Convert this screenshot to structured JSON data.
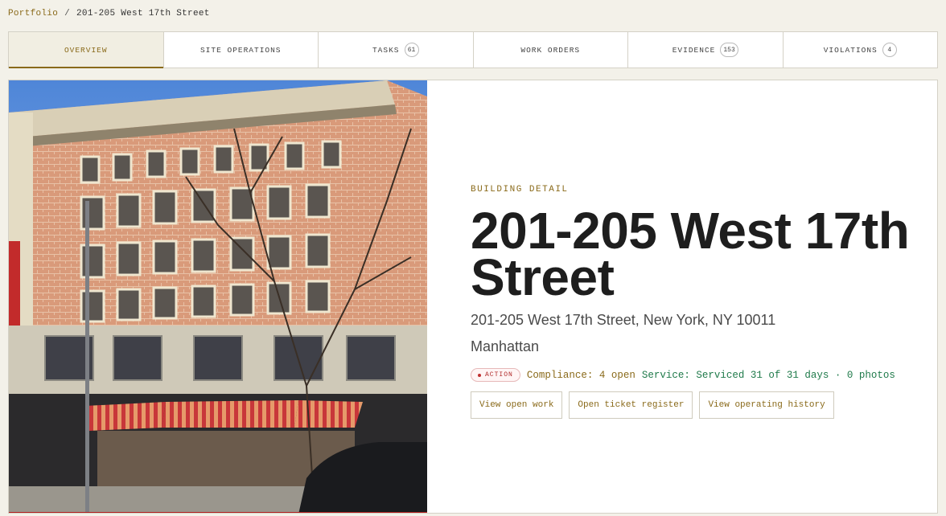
{
  "breadcrumb": {
    "root": "Portfolio",
    "separator": "/",
    "current": "201-205 West 17th Street"
  },
  "tabs": [
    {
      "label": "OVERVIEW",
      "badge": null
    },
    {
      "label": "SITE OPERATIONS",
      "badge": null
    },
    {
      "label": "TASKS",
      "badge": "61"
    },
    {
      "label": "WORK ORDERS",
      "badge": null
    },
    {
      "label": "EVIDENCE",
      "badge": "153"
    },
    {
      "label": "VIOLATIONS",
      "badge": "4"
    }
  ],
  "building": {
    "eyebrow": "BUILDING DETAIL",
    "title_line1": "201-205 West 17th",
    "title_line2": "Street",
    "address": "201-205 West 17th Street, New York, NY 10011",
    "borough": "Manhattan",
    "action_label": "ACTION",
    "compliance": "Compliance: 4 open",
    "service": "Service: Serviced 31 of 31 days · 0 photos"
  },
  "buttons": {
    "open_work": "View open work",
    "ticket_register": "Open ticket register",
    "operating_history": "View operating history"
  },
  "colors": {
    "accent": "#8a6a1a",
    "service": "#1f7a4a",
    "alert": "#b02a2a"
  }
}
